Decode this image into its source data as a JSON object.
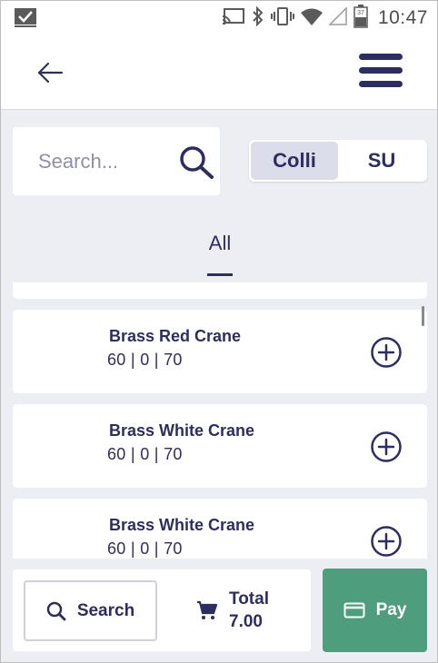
{
  "status_bar": {
    "time": "10:47",
    "battery_level": "37"
  },
  "search": {
    "placeholder": "Search..."
  },
  "toggle": {
    "options": [
      "Colli",
      "SU"
    ],
    "selected": "Colli"
  },
  "tabs": {
    "active_label": "All"
  },
  "items": [
    {
      "name": "Brass Red Crane",
      "meta": "60  | 0  | 70"
    },
    {
      "name": "Brass White Crane",
      "meta": "60  | 0  | 70"
    },
    {
      "name": "Brass White Crane",
      "meta": "60  | 0  | 70"
    }
  ],
  "bottom": {
    "search_label": "Search",
    "total_label": "Total",
    "total_value": "7.00",
    "pay_label": "Pay"
  },
  "colors": {
    "primary": "#2d2e5f",
    "background": "#eceef4",
    "pay": "#4e9d7c",
    "toggle_active": "#dcddeb"
  }
}
